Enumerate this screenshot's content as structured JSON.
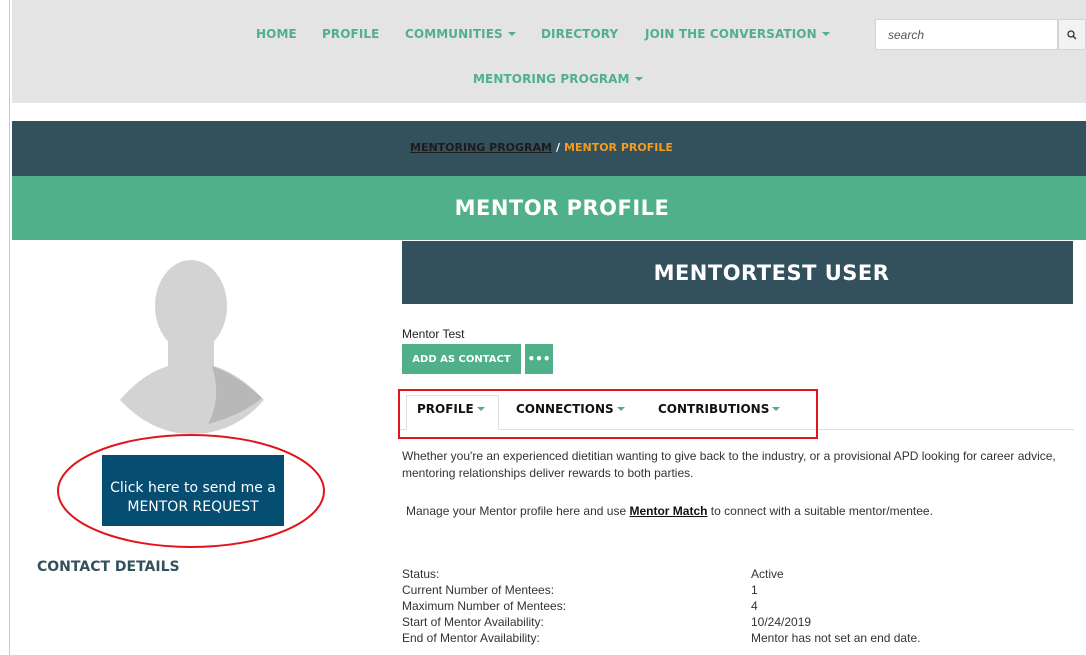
{
  "nav": {
    "items": [
      {
        "label": "HOME",
        "dropdown": false
      },
      {
        "label": "PROFILE",
        "dropdown": false
      },
      {
        "label": "COMMUNITIES",
        "dropdown": true
      },
      {
        "label": "DIRECTORY",
        "dropdown": false
      },
      {
        "label": "JOIN THE CONVERSATION",
        "dropdown": true
      },
      {
        "label": "MENTORING PROGRAM",
        "dropdown": true
      }
    ],
    "search_placeholder": "search",
    "search_icon": "search-icon"
  },
  "breadcrumb": {
    "parent": "MENTORING PROGRAM",
    "separator": "/",
    "current": "MENTOR PROFILE"
  },
  "page_title": "MENTOR PROFILE",
  "sidebar": {
    "request_line1": "Click here to send me a",
    "request_line2": "MENTOR REQUEST",
    "contact_heading": "CONTACT DETAILS"
  },
  "profile": {
    "name_banner": "MENTORTEST USER",
    "subtitle": "Mentor Test",
    "add_contact_label": "ADD AS CONTACT",
    "more_label": "•••",
    "tabs": [
      {
        "label": "PROFILE",
        "active": true
      },
      {
        "label": "CONNECTIONS",
        "active": false
      },
      {
        "label": "CONTRIBUTIONS",
        "active": false
      }
    ],
    "intro": "Whether you're an experienced dietitian wanting to give back to the industry, or a provisional APD looking for career advice, mentoring relationships deliver rewards to both parties.",
    "manage_prefix": "Manage your Mentor profile here and use ",
    "manage_link": "Mentor Match",
    "manage_suffix": " to connect with a suitable mentor/mentee.",
    "details": [
      {
        "label": "Status:",
        "value": "Active"
      },
      {
        "label": "Current Number of Mentees:",
        "value": "1"
      },
      {
        "label": "Maximum Number of Mentees:",
        "value": "4"
      },
      {
        "label": "Start of Mentor Availability:",
        "value": "10/24/2019"
      },
      {
        "label": "End of Mentor Availability:",
        "value": "Mentor has not set an end date."
      }
    ]
  },
  "colors": {
    "green": "#4fb089",
    "slate": "#33515c",
    "navy_button": "#064d72",
    "orange_crumb": "#f39c22",
    "annotation_red": "#e0141a"
  }
}
